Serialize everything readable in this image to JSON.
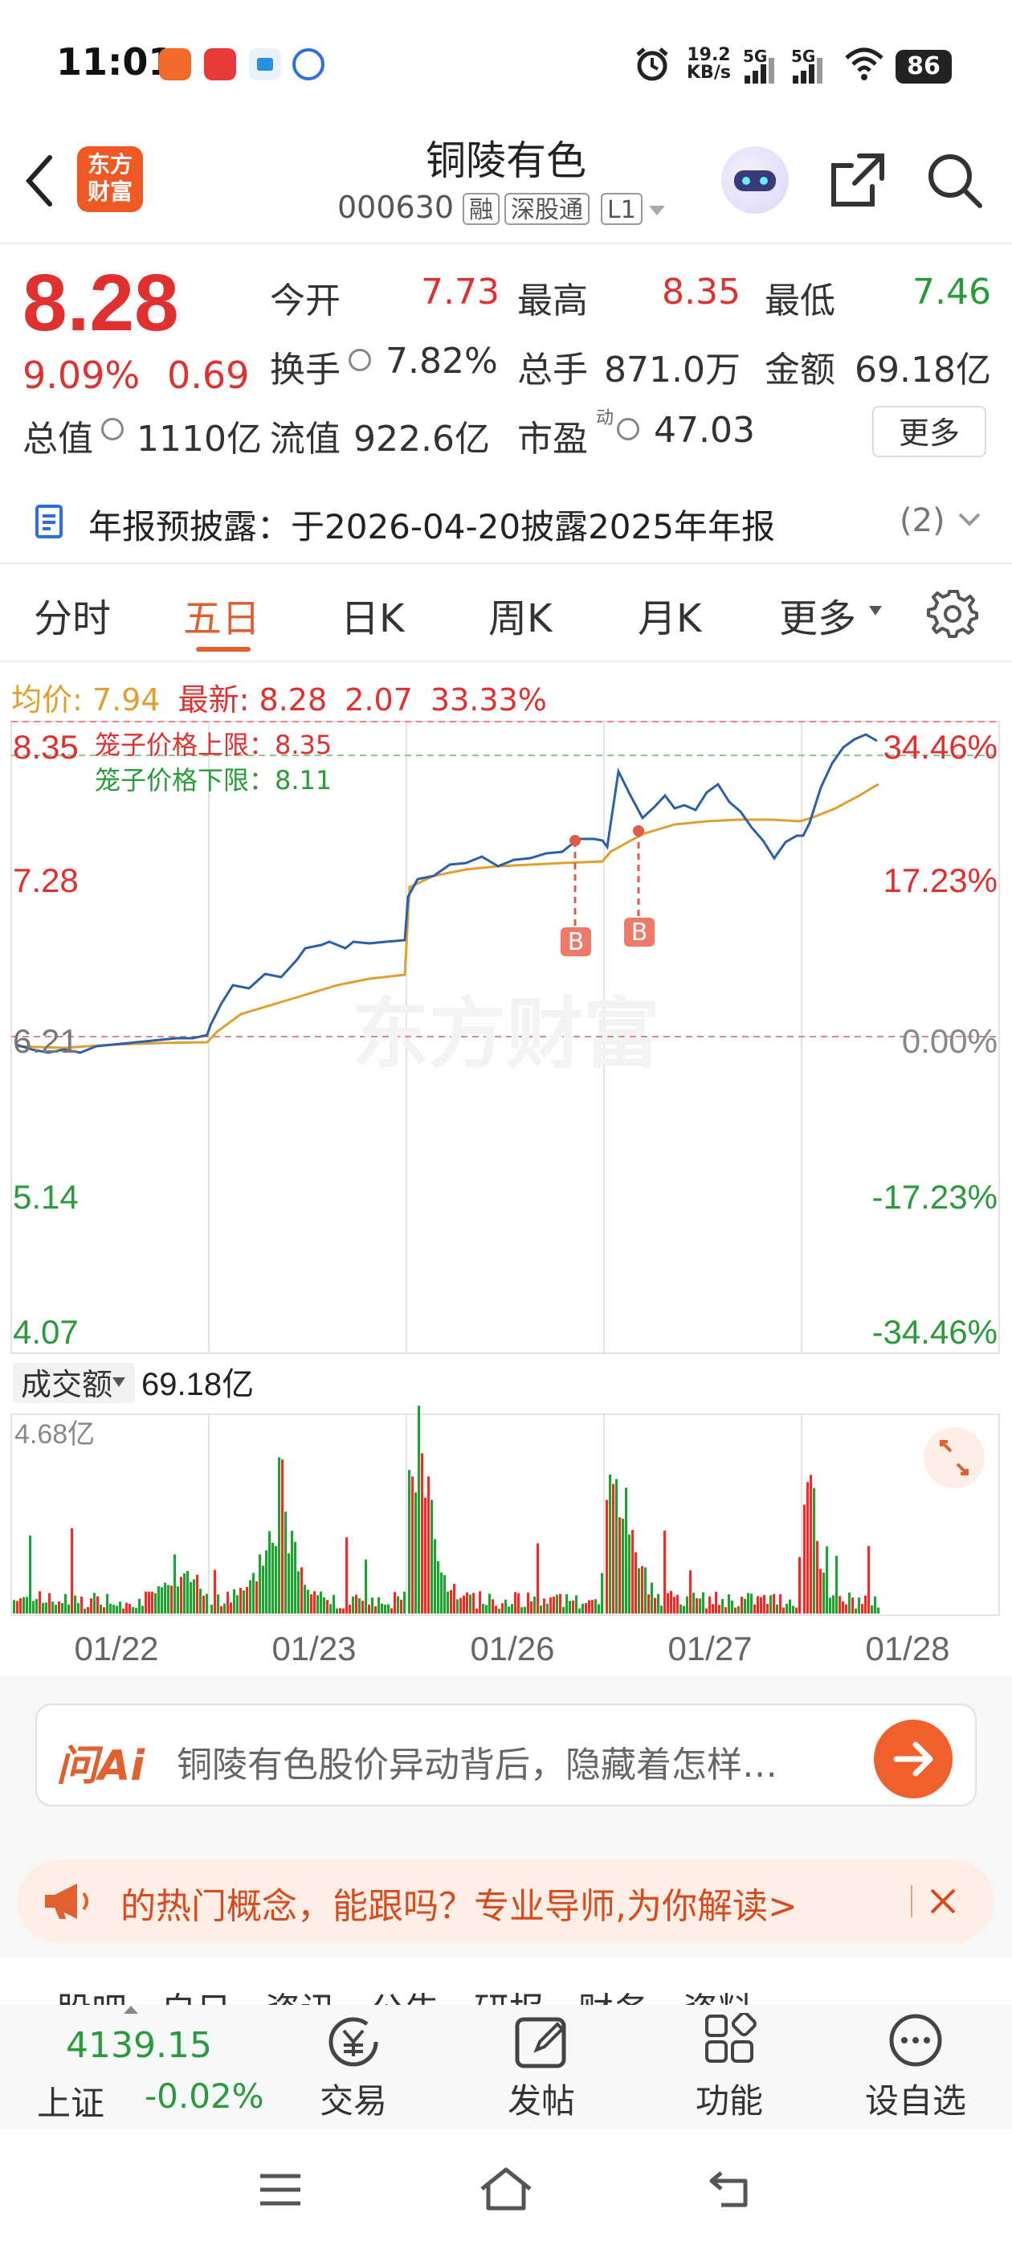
{
  "status_bar": {
    "time": "11:01",
    "net_speed_value": "19.2",
    "net_speed_unit": "KB/s",
    "signal1": "5G",
    "signal2": "5G",
    "battery": "86"
  },
  "header": {
    "logo_line1": "东方",
    "logo_line2": "财富",
    "title": "铜陵有色",
    "code": "000630",
    "tag_rong": "融",
    "tag_sgt": "深股通",
    "tag_level": "L1"
  },
  "quote": {
    "price": "8.28",
    "change_pct": "9.09%",
    "change_amt": "0.69",
    "open_label": "今开",
    "open": "7.73",
    "high_label": "最高",
    "high": "8.35",
    "low_label": "最低",
    "low": "7.46",
    "turnover_label": "换手",
    "turnover": "7.82%",
    "volume_label": "总手",
    "volume": "871.0万",
    "amount_label": "金额",
    "amount": "69.18亿",
    "mktcap_label": "总值",
    "mktcap": "1110亿",
    "float_label": "流值",
    "float": "922.6亿",
    "pe_label": "市盈",
    "pe_sup": "动",
    "pe": "47.03",
    "more": "更多"
  },
  "notice": {
    "text": "年报预披露：于2026-04-20披露2025年年报",
    "count": "(2)"
  },
  "tabs": [
    "分时",
    "五日",
    "日K",
    "周K",
    "月K",
    "更多"
  ],
  "chart": {
    "avg_label": "均价:",
    "avg_value": "7.94",
    "latest_label": "最新:",
    "latest_value": "8.28",
    "latest_change": "2.07",
    "latest_pct": "33.33%",
    "upper_limit_text": "笼子价格上限：8.35",
    "lower_limit_text": "笼子价格下限：8.11",
    "watermark": "东方财富",
    "marker_label": "B",
    "volume_label": "成交额",
    "volume_total": "69.18亿",
    "volume_max": "4.68亿",
    "left_axis": [
      "8.35",
      "7.28",
      "6.21",
      "5.14",
      "4.07"
    ],
    "right_axis": [
      "34.46%",
      "17.23%",
      "0.00%",
      "-17.23%",
      "-34.46%"
    ],
    "dates": [
      "01/22",
      "01/23",
      "01/26",
      "01/27",
      "01/28"
    ],
    "colors": {
      "up": "#e0302f",
      "down": "#2a9a3a",
      "price_line": "#2d5fa8",
      "avg_line": "#e0a030"
    }
  },
  "chart_data": {
    "type": "line",
    "x": [
      "01/22",
      "01/23",
      "01/26",
      "01/27",
      "01/28"
    ],
    "ylim": [
      4.07,
      8.35
    ],
    "series": [
      {
        "name": "最新",
        "values": [
          6.2,
          7.05,
          7.52,
          7.75,
          8.28
        ]
      },
      {
        "name": "均价",
        "values": [
          6.21,
          6.55,
          7.35,
          7.62,
          7.94
        ]
      }
    ]
  },
  "ai": {
    "logo": "问Ai",
    "text": "铜陵有色股价异动背后，隐藏着怎样…"
  },
  "banner": {
    "text": "的热门概念，能跟吗？专业导师,为你解读>"
  },
  "bottom_nav": {
    "index_value": "4139.15",
    "index_name": "上证",
    "index_change": "-0.02%",
    "items": [
      "交易",
      "发帖",
      "功能",
      "设自选"
    ]
  },
  "peek_tabs": "股吧   自日   资讯   公告   研报   财务   资料"
}
